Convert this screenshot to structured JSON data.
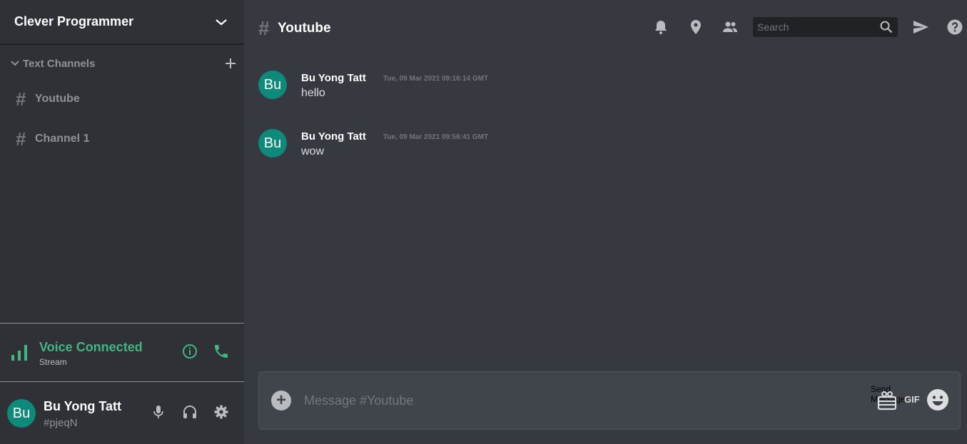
{
  "sidebar": {
    "server_name": "Clever Programmer",
    "category_label": "Text Channels",
    "channels": [
      {
        "hash": "#",
        "name": "Youtube"
      },
      {
        "hash": "#",
        "name": "Channel 1"
      }
    ]
  },
  "voice": {
    "title": "Voice Connected",
    "subtitle": "Stream"
  },
  "user": {
    "avatar_text": "Bu",
    "name": "Bu Yong Tatt",
    "tag": "#pjeqN"
  },
  "chat_header": {
    "hash": "#",
    "channel_name": "Youtube",
    "search_placeholder": "Search",
    "icons": [
      "bell-icon",
      "pin-icon",
      "members-icon",
      "search-icon",
      "send-icon",
      "help-icon"
    ]
  },
  "messages": [
    {
      "avatar_text": "Bu",
      "author": "Bu Yong Tatt",
      "timestamp": "Tue, 09 Mar 2021 09:16:14 GMT",
      "text": "hello"
    },
    {
      "avatar_text": "Bu",
      "author": "Bu Yong Tatt",
      "timestamp": "Tue, 09 Mar 2021 09:56:41 GMT",
      "text": "wow"
    }
  ],
  "composer": {
    "add_label": "+",
    "placeholder": "Message #Youtube",
    "send_label": "Send Message",
    "gif_label": "GIF"
  },
  "colors": {
    "sidebar_bg": "#2f3136",
    "chat_bg": "#36393f",
    "accent_green": "#43b581",
    "avatar_bg": "#0e8a7b"
  }
}
